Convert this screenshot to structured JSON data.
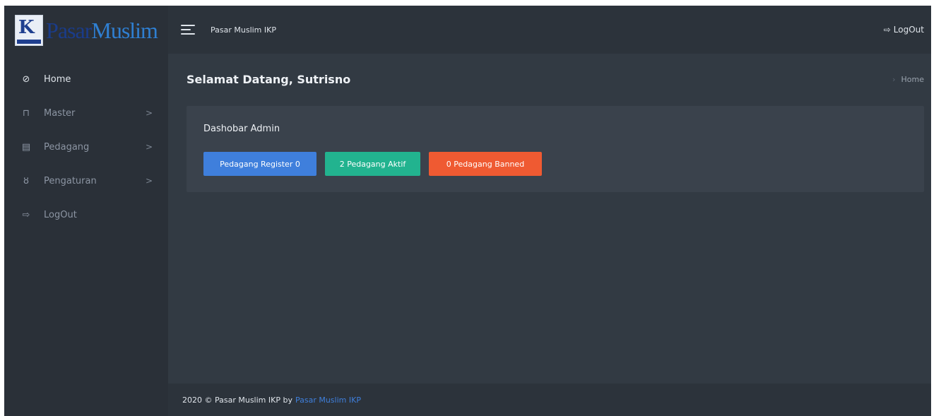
{
  "brand": {
    "logo_text_part1": "Pasar",
    "logo_text_part2": "Muslim"
  },
  "sidebar": {
    "items": [
      {
        "label": "Home",
        "icon": "dashboard-icon",
        "glyph": "⊘",
        "has_chevron": false
      },
      {
        "label": "Master",
        "icon": "building-icon",
        "glyph": "⊓",
        "has_chevron": true
      },
      {
        "label": "Pedagang",
        "icon": "clipboard-icon",
        "glyph": "▤",
        "has_chevron": true
      },
      {
        "label": "Pengaturan",
        "icon": "user-settings-icon",
        "glyph": "ȣ",
        "has_chevron": true
      },
      {
        "label": "LogOut",
        "icon": "logout-icon",
        "glyph": "⇨",
        "has_chevron": false
      }
    ],
    "chevron": ">"
  },
  "topbar": {
    "title": "Pasar Muslim IKP",
    "logout_label": "LogOut",
    "logout_icon": "⇨"
  },
  "page": {
    "title": "Selamat Datang, Sutrisno",
    "breadcrumb": [
      "Home"
    ]
  },
  "card": {
    "title": "Dashobar Admin",
    "buttons": [
      {
        "label": "Pedagang Register 0",
        "color": "#3f7fdc"
      },
      {
        "label": "2 Pedagang Aktif",
        "color": "#22b38f"
      },
      {
        "label": "0 Pedagang Banned",
        "color": "#ef5a32"
      }
    ]
  },
  "footer": {
    "text": "2020 © Pasar Muslim IKP by",
    "link": "Pasar Muslim IKP"
  },
  "colors": {
    "sidebar_bg": "#2a3038",
    "content_bg": "#323a43",
    "card_bg": "#3a424c",
    "link": "#3f7fdc"
  }
}
